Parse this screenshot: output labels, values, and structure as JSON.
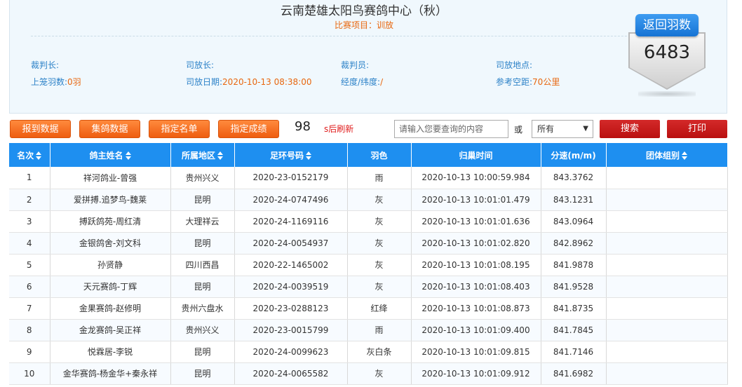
{
  "header": {
    "title": "云南楚雄太阳鸟赛鸽中心（秋）",
    "subtitle": "比赛项目：训放"
  },
  "info": {
    "referee_label": "裁判长:",
    "referee_value": "",
    "releaser_label": "司放长:",
    "releaser_value": "",
    "judge_label": "裁判员:",
    "judge_value": "",
    "release_location_label": "司放地点:",
    "release_location_value": "",
    "loft_count_label": "上笼羽数:",
    "loft_count_value": "0羽",
    "release_date_label": "司放日期:",
    "release_date_value": "2020-10-13 08:38:00",
    "coords_label": "经度/纬度:",
    "coords_value": "/",
    "distance_label": "参考空距:",
    "distance_value": "70公里"
  },
  "badge": {
    "label": "返回羽数",
    "count": "6483"
  },
  "toolbar": {
    "btn_arrival": "报到数据",
    "btn_collect": "集鸽数据",
    "btn_names": "指定名单",
    "btn_results": "指定成绩",
    "countdown_value": "98",
    "countdown_text": "s后刷新",
    "search_placeholder": "请输入您要查询的内容",
    "or_text": "或",
    "select_value": "所有",
    "btn_search": "搜索",
    "btn_print": "打印"
  },
  "table": {
    "headers": [
      "名次",
      "鸽主姓名",
      "所属地区",
      "足环号码",
      "羽色",
      "归巢时间",
      "分速(m/m)",
      "团体组别"
    ],
    "rows": [
      [
        "1",
        "祥河鸽业-曾强",
        "贵州兴义",
        "2020-23-0152179",
        "雨",
        "2020-10-13 10:00:59.984",
        "843.3762",
        ""
      ],
      [
        "2",
        "爱拼搏.追梦鸟-魏莱",
        "昆明",
        "2020-24-0747496",
        "灰",
        "2020-10-13 10:01:01.479",
        "843.1231",
        ""
      ],
      [
        "3",
        "搏跃鸽苑-周红清",
        "大理祥云",
        "2020-24-1169116",
        "灰",
        "2020-10-13 10:01:01.636",
        "843.0964",
        ""
      ],
      [
        "4",
        "金银鸽舍-刘文科",
        "昆明",
        "2020-24-0054937",
        "灰",
        "2020-10-13 10:01:02.820",
        "842.8962",
        ""
      ],
      [
        "5",
        "孙贤静",
        "四川西昌",
        "2020-22-1465002",
        "灰",
        "2020-10-13 10:01:08.195",
        "841.9878",
        ""
      ],
      [
        "6",
        "天元赛鸽-丁辉",
        "昆明",
        "2020-24-0039519",
        "灰",
        "2020-10-13 10:01:08.403",
        "841.9528",
        ""
      ],
      [
        "7",
        "金果赛鸽-赵修明",
        "贵州六盘水",
        "2020-23-0288123",
        "红绛",
        "2020-10-13 10:01:08.873",
        "841.8735",
        ""
      ],
      [
        "8",
        "金龙赛鸽-吴正祥",
        "贵州兴义",
        "2020-23-0015799",
        "雨",
        "2020-10-13 10:01:09.400",
        "841.7845",
        ""
      ],
      [
        "9",
        "悦霖居-李锐",
        "昆明",
        "2020-24-0099623",
        "灰白条",
        "2020-10-13 10:01:09.815",
        "841.7146",
        ""
      ],
      [
        "10",
        "金华赛鸽-杨金华+秦永祥",
        "昆明",
        "2020-24-0065582",
        "灰",
        "2020-10-13 10:01:09.912",
        "841.6982",
        ""
      ]
    ]
  },
  "colors": {
    "accent_blue": "#1e8ff0",
    "orange": "#ee5d10",
    "red": "#c41a1a"
  }
}
